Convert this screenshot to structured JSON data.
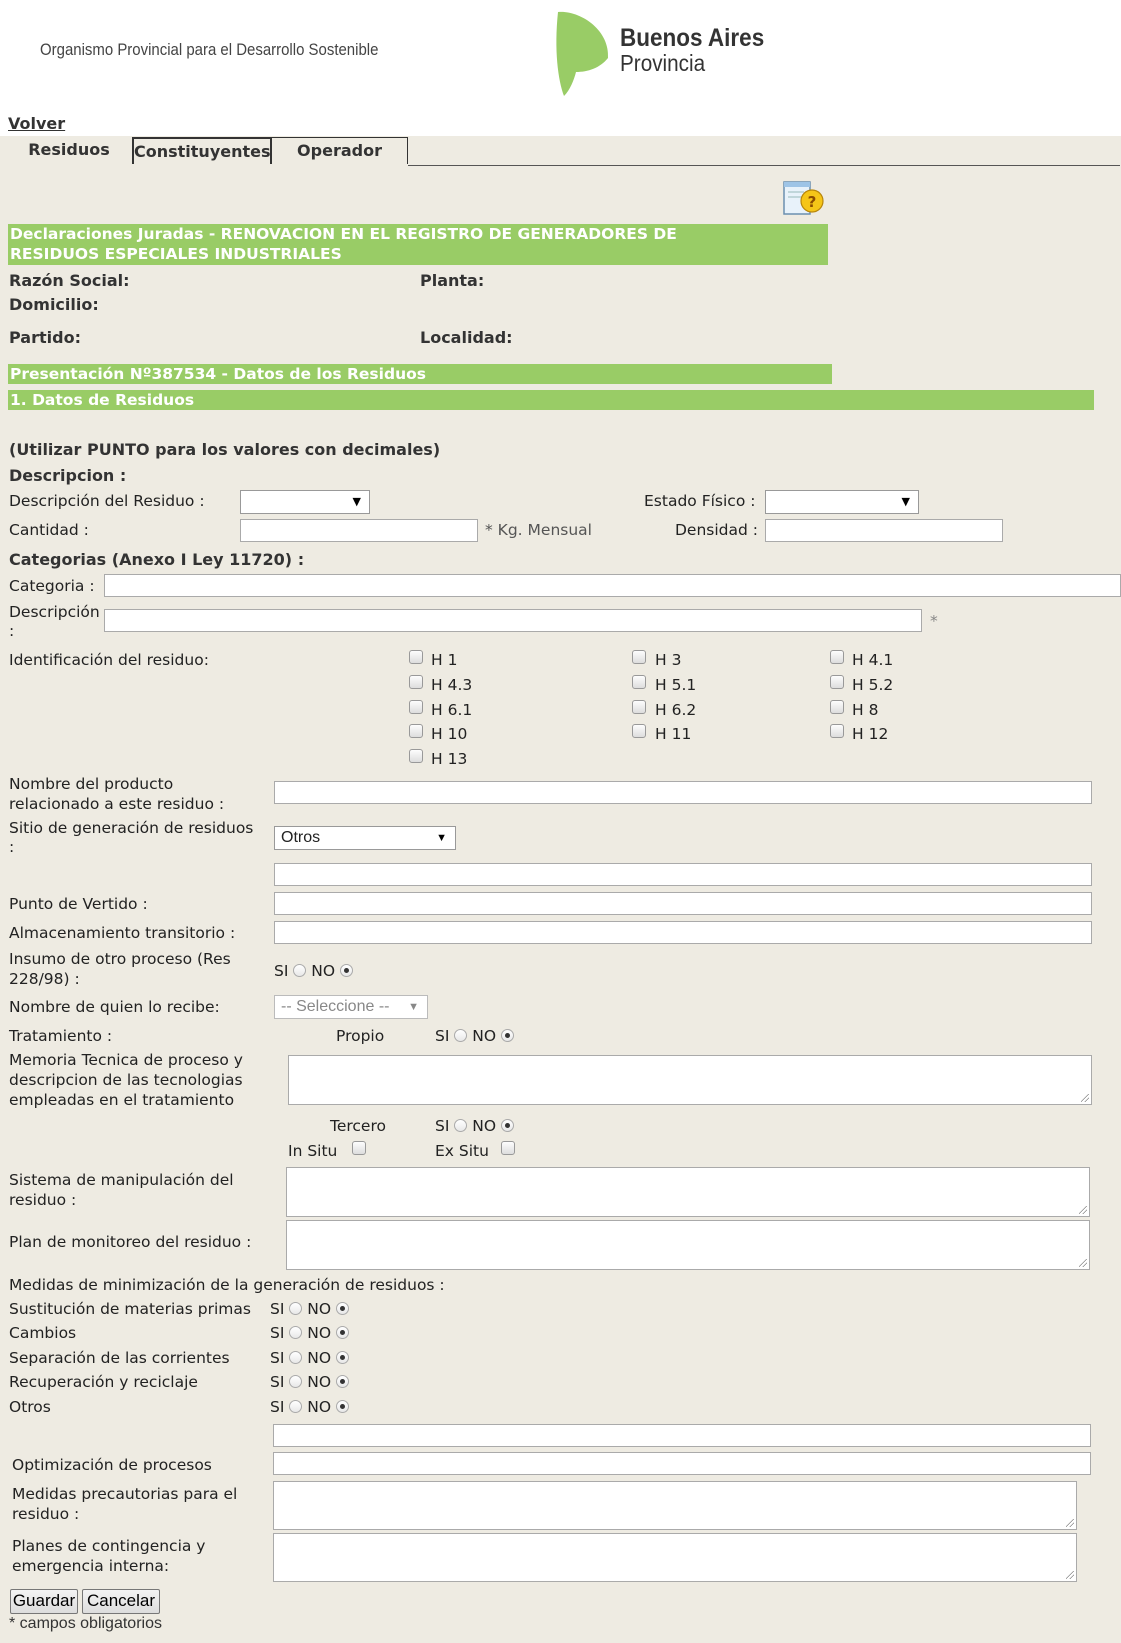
{
  "header": {
    "org_name": "Organismo Provincial para el Desarrollo Sostenible",
    "logo_line1": "Buenos Aires",
    "logo_line2": "Provincia",
    "logo_color": "#99cc66"
  },
  "nav": {
    "back_link": "Volver",
    "tabs": [
      "Residuos",
      "Constituyentes",
      "Operador"
    ],
    "active_tab": "Residuos",
    "help_icon": "help-question-icon"
  },
  "banner": {
    "title_line1": "Declaraciones Juradas - RENOVACION EN EL REGISTRO DE GENERADORES DE",
    "title_line2": "RESIDUOS ESPECIALES INDUSTRIALES"
  },
  "company": {
    "razon_social_label": "Razón Social:",
    "planta_label": "Planta:",
    "domicilio_label": "Domicilio:",
    "partido_label": "Partido:",
    "localidad_label": "Localidad:"
  },
  "presentacion_banner": "Presentación Nº387534 - Datos de los Residuos",
  "section_banner": "1. Datos de Residuos",
  "form": {
    "decimal_note": "(Utilizar PUNTO para los valores con decimales)",
    "descripcion_heading": "Descripcion :",
    "descripcion_residuo_label": "Descripción del Residuo :",
    "descripcion_residuo_value": "",
    "estado_fisico_label": "Estado Físico :",
    "estado_fisico_value": "",
    "cantidad_label": "Cantidad :",
    "cantidad_value": "",
    "cantidad_unit": "* Kg. Mensual",
    "densidad_label": "Densidad :",
    "densidad_value": "",
    "categorias_heading": "Categorias (Anexo I Ley 11720) :",
    "categoria_label": "Categoria :",
    "categoria_value": "",
    "descripcion_label_1": "Descripción",
    "descripcion_label_2": ":",
    "descripcion_value": "",
    "required_mark": "*",
    "identificacion_label": "Identificación del residuo:",
    "h_codes": {
      "col1": [
        "H 1",
        "H 4.3",
        "H 6.1",
        "H 10",
        "H 13"
      ],
      "col2": [
        "H 3",
        "H 5.1",
        "H 6.2",
        "H 11"
      ],
      "col3": [
        "H 4.1",
        "H 5.2",
        "H 8",
        "H 12"
      ]
    },
    "producto_label_1": "Nombre del producto",
    "producto_label_2": "relacionado a este residuo :",
    "producto_value": "",
    "sitio_label_1": "Sitio de generación de residuos",
    "sitio_label_2": ":",
    "sitio_value": "Otros",
    "sitio_otros_value": "",
    "punto_vertido_label": "Punto de Vertido :",
    "punto_vertido_value": "",
    "almacenamiento_label": "Almacenamiento transitorio :",
    "almacenamiento_value": "",
    "insumo_label_1": "Insumo de otro proceso (Res",
    "insumo_label_2": "228/98) :",
    "si_label": "SI",
    "no_label": "NO",
    "recibe_label": "Nombre de quien lo recibe:",
    "recibe_placeholder": "-- Seleccione --",
    "tratamiento_label": "Tratamiento :",
    "propio_label": "Propio",
    "memoria_label_1": "Memoria Tecnica de proceso y",
    "memoria_label_2": "descripcion de las tecnologias",
    "memoria_label_3": "empleadas en el tratamiento",
    "tercero_label": "Tercero",
    "in_situ_label": "In Situ",
    "ex_situ_label": "Ex Situ",
    "manipulacion_label_1": "Sistema de manipulación del",
    "manipulacion_label_2": "residuo :",
    "monitoreo_label": "Plan de monitoreo del residuo :",
    "minimizacion_heading": "Medidas de minimización de la generación de residuos :",
    "minimizacion_items": [
      "Sustitución de materias primas",
      "Cambios",
      "Separación de las corrientes",
      "Recuperación y reciclaje",
      "Otros"
    ],
    "optimizacion_label": "Optimización de procesos",
    "precautorias_label_1": "Medidas precautorias para el",
    "precautorias_label_2": "residuo :",
    "contingencia_label_1": "Planes de contingencia y",
    "contingencia_label_2": "emergencia interna:",
    "save_button": "Guardar",
    "cancel_button": "Cancelar",
    "required_note": "* campos obligatorios"
  }
}
